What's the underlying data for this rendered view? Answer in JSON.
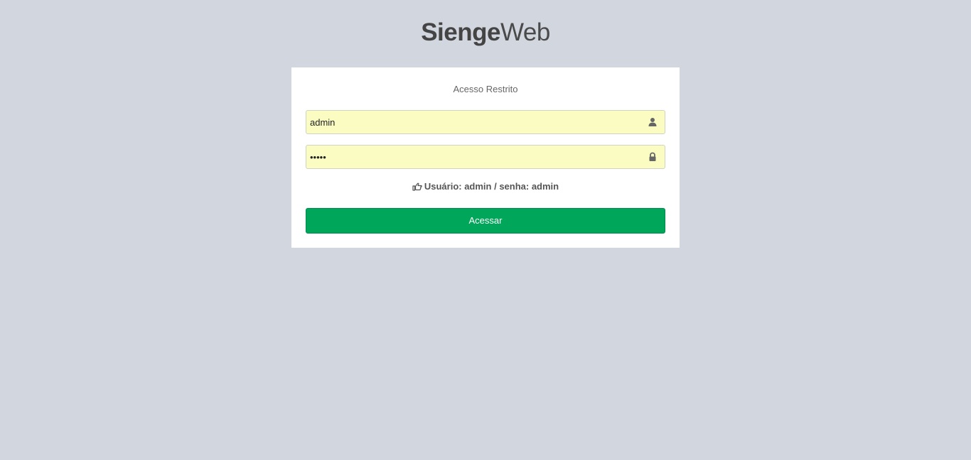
{
  "logo": {
    "bold": "Sienge",
    "light": "Web"
  },
  "login": {
    "box_msg": "Acesso Restrito",
    "username_value": "admin",
    "password_value": "admin",
    "hint_text": "Usuário: admin / senha: admin",
    "submit_label": "Acessar"
  },
  "icons": {
    "username": "user-icon",
    "password": "lock-icon",
    "hint": "hand-pointing-right-icon"
  },
  "colors": {
    "background": "#d2d6de",
    "button": "#00a65a",
    "input_autofill": "#fafcc2"
  }
}
